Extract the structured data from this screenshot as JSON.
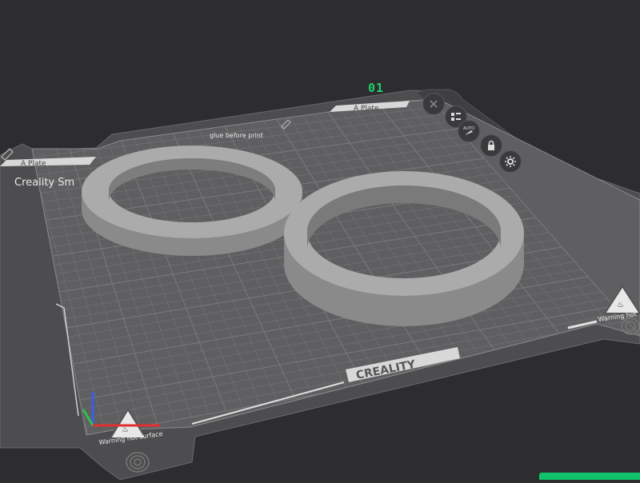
{
  "plate": {
    "number": "01",
    "label_top": "A Plate",
    "label_left": "A Plate",
    "brand": "CREALITY",
    "corner_title": "Creality Sm",
    "glue_notice": "glue before print",
    "warning_left": "Warning hot surface",
    "warning_right": "Warning hot"
  },
  "toolbar": {
    "buttons": [
      {
        "name": "close-plate-button",
        "icon": "close-icon"
      },
      {
        "name": "arrange-button",
        "icon": "arrange-icon"
      },
      {
        "name": "auto-orient-button",
        "icon": "auto-orient-icon",
        "label": "AUTO"
      },
      {
        "name": "lock-plate-button",
        "icon": "lock-icon"
      },
      {
        "name": "plate-settings-button",
        "icon": "gear-icon"
      }
    ]
  },
  "objects": [
    {
      "name": "ring-object-1",
      "type": "ring"
    },
    {
      "name": "ring-object-2",
      "type": "ring"
    }
  ],
  "colors": {
    "background": "#2d2d2f",
    "plate_surface": "#5e5e60",
    "grid_line": "#7a7a7c",
    "object": "#a9a9a9",
    "accent": "#1fd26b",
    "axis_x": "#e0312f",
    "axis_y": "#2ec24a",
    "axis_z": "#3a5ee8"
  }
}
